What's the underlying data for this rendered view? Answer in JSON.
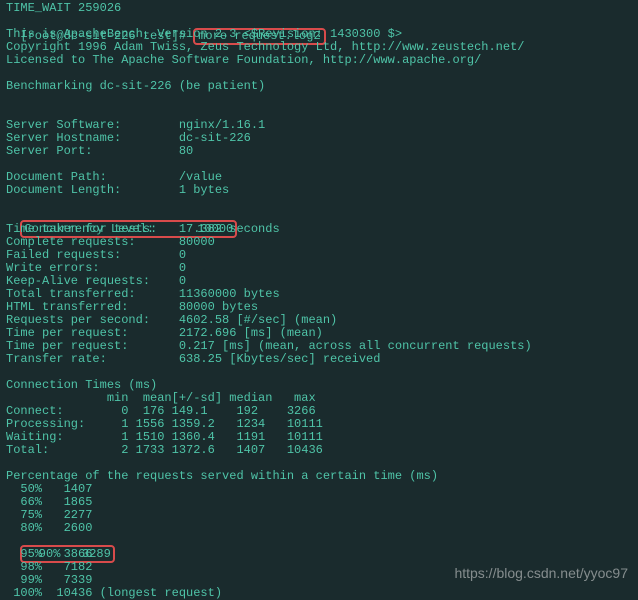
{
  "top_cut": "TIME_WAIT 259026",
  "prompt": "[root@dc-sit-226 test]# ",
  "command": "more request.log2",
  "header": {
    "l1": "This is ApacheBench, Version 2.3 <$Revision: 1430300 $>",
    "l2": "Copyright 1996 Adam Twiss, Zeus Technology Ltd, http://www.zeustech.net/",
    "l3": "Licensed to The Apache Software Foundation, http://www.apache.org/"
  },
  "bench": "Benchmarking dc-sit-226 (be patient)",
  "server": {
    "software": "Server Software:        nginx/1.16.1",
    "hostname": "Server Hostname:        dc-sit-226",
    "port": "Server Port:            80"
  },
  "doc": {
    "path": "Document Path:          /value",
    "length": "Document Length:        1 bytes"
  },
  "conc": {
    "level": "Concurrency Level:      10000"
  },
  "timing": {
    "taken": "Time taken for tests:   17.382 seconds",
    "complete": "Complete requests:      80000",
    "failed": "Failed requests:        0",
    "write": "Write errors:           0",
    "keepalive": "Keep-Alive requests:    0",
    "totaltx": "Total transferred:      11360000 bytes",
    "htmltx": "HTML transferred:       80000 bytes",
    "rps": "Requests per second:    4602.58 [#/sec] (mean)",
    "tpr1": "Time per request:       2172.696 [ms] (mean)",
    "tpr2": "Time per request:       0.217 [ms] (mean, across all concurrent requests)",
    "rate": "Transfer rate:          638.25 [Kbytes/sec] received"
  },
  "ct": {
    "title": "Connection Times (ms)",
    "hdr": "              min  mean[+/-sd] median   max",
    "connect": "Connect:        0  176 149.1    192    3266",
    "proc": "Processing:     1 1556 1359.2   1234   10111",
    "wait": "Waiting:        1 1510 1360.4   1191   10111",
    "total": "Total:          2 1733 1372.6   1407   10436"
  },
  "pct": {
    "title": "Percentage of the requests served within a certain time (ms)",
    "p50": "  50%   1407",
    "p66": "  66%   1865",
    "p75": "  75%   2277",
    "p80": "  80%   2600",
    "p90": "  90%   3289",
    "p95": "  95%   3866",
    "p98": "  98%   7182",
    "p99": "  99%   7339",
    "p100": " 100%  10436 (longest request)"
  },
  "watermark": "https://blog.csdn.net/yyoc97"
}
